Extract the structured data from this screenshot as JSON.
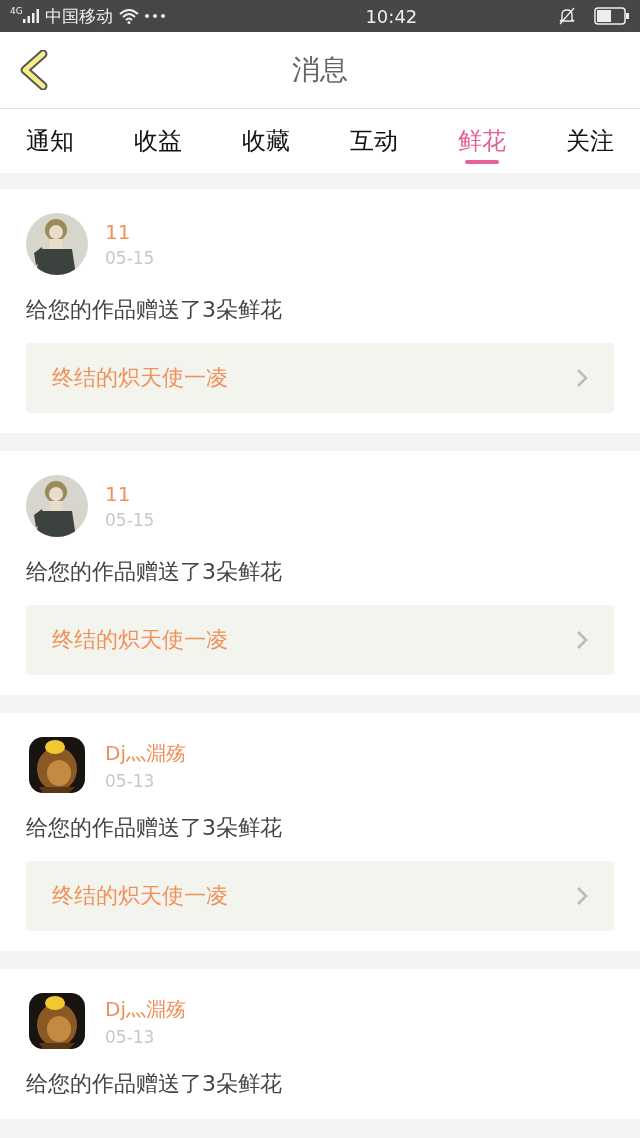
{
  "status_bar": {
    "network": "4G",
    "carrier": "中国移动",
    "time": "10:42"
  },
  "header": {
    "title": "消息"
  },
  "tabs": [
    {
      "label": "通知",
      "selected": false
    },
    {
      "label": "收益",
      "selected": false
    },
    {
      "label": "收藏",
      "selected": false
    },
    {
      "label": "互动",
      "selected": false
    },
    {
      "label": "鲜花",
      "selected": true
    },
    {
      "label": "关注",
      "selected": false
    }
  ],
  "messages": [
    {
      "user": "11",
      "date": "05-15",
      "text": "给您的作品赠送了3朵鲜花",
      "work": "终结的炽天使一凌"
    },
    {
      "user": "11",
      "date": "05-15",
      "text": "给您的作品赠送了3朵鲜花",
      "work": "终结的炽天使一凌"
    },
    {
      "user": "Dj灬淵殇",
      "date": "05-13",
      "text": "给您的作品赠送了3朵鲜花",
      "work": "终结的炽天使一凌"
    },
    {
      "user": "Dj灬淵殇",
      "date": "05-13",
      "text": "给您的作品赠送了3朵鲜花"
    }
  ]
}
